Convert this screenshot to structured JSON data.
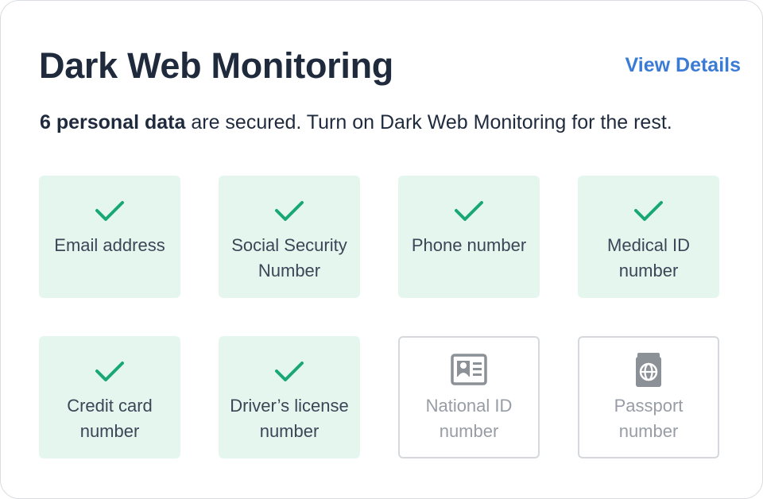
{
  "card": {
    "title": "Dark Web Monitoring",
    "view_details_label": "View Details",
    "subtitle_bold": "6 personal data",
    "subtitle_rest": " are secured. Turn on Dark Web Monitoring for the rest."
  },
  "items": [
    {
      "label": "Email address",
      "status": "secured",
      "icon": "checkmark-icon"
    },
    {
      "label": "Social Security Number",
      "status": "secured",
      "icon": "checkmark-icon"
    },
    {
      "label": "Phone number",
      "status": "secured",
      "icon": "checkmark-icon"
    },
    {
      "label": "Medical ID number",
      "status": "secured",
      "icon": "checkmark-icon"
    },
    {
      "label": "Credit card number",
      "status": "secured",
      "icon": "checkmark-icon"
    },
    {
      "label": "Driver’s license number",
      "status": "secured",
      "icon": "checkmark-icon"
    },
    {
      "label": "National ID number",
      "status": "not-secured",
      "icon": "id-card-icon"
    },
    {
      "label": "Passport number",
      "status": "not-secured",
      "icon": "passport-icon"
    }
  ],
  "colors": {
    "title": "#1f2b3d",
    "link": "#3a7bd5",
    "secured_bg": "#e5f6ef",
    "check": "#19a874",
    "disabled_text": "#979ca5",
    "disabled_icon": "#8c9097"
  }
}
